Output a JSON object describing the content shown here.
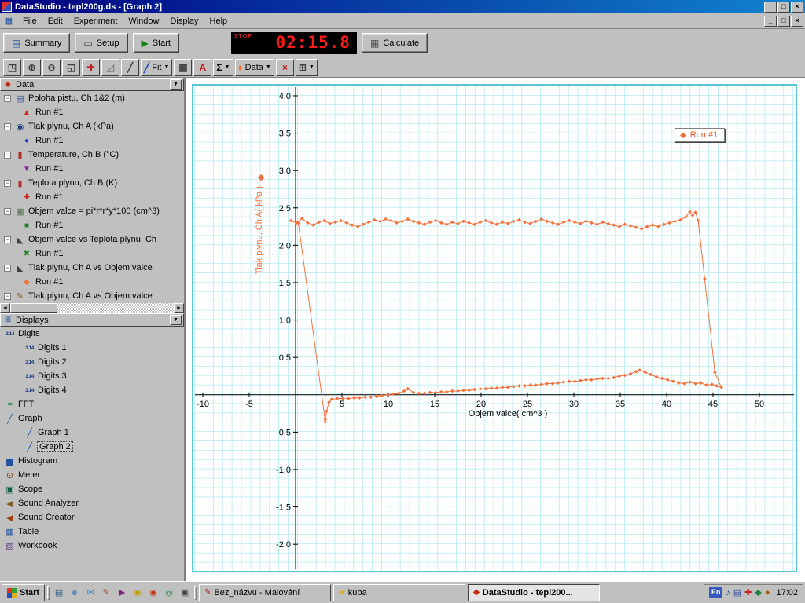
{
  "window": {
    "title": "DataStudio - tepl200g.ds - [Graph 2]"
  },
  "menu": {
    "items": [
      "File",
      "Edit",
      "Experiment",
      "Window",
      "Display",
      "Help"
    ]
  },
  "toolbar": {
    "summary": "Summary",
    "setup": "Setup",
    "start": "Start",
    "timer": {
      "stop_label": "STOP",
      "value": "02:15.8"
    },
    "calculate": "Calculate"
  },
  "graph_toolbar": {
    "buttons": [
      {
        "name": "scale-to-fit-button",
        "glyph": "◳",
        "color": "#404040"
      },
      {
        "name": "zoom-in-button",
        "glyph": "⊕",
        "color": "#404040"
      },
      {
        "name": "zoom-out-button",
        "glyph": "⊖",
        "color": "#404040"
      },
      {
        "name": "zoom-select-button",
        "glyph": "◱",
        "color": "#404040"
      },
      {
        "name": "smart-tool-button",
        "glyph": "✚",
        "color": "#c02020"
      },
      {
        "name": "slope-tool-button",
        "glyph": "◿",
        "color": "#808080"
      },
      {
        "name": "note-tool-button",
        "glyph": "╱",
        "color": "#404040"
      },
      {
        "name": "fit-menu-button",
        "glyph": "╱",
        "color": "#2040c0",
        "label": "Fit",
        "dropdown": true
      },
      {
        "name": "calculator-tool-button",
        "glyph": "▦",
        "color": "#404040"
      },
      {
        "name": "text-tool-button",
        "glyph": "A",
        "color": "#c02020"
      },
      {
        "name": "statistics-menu-button",
        "glyph": "Σ",
        "color": "#000000",
        "dropdown": true
      },
      {
        "name": "data-menu-button",
        "glyph": "♦",
        "color": "#f4713c",
        "label": "Data",
        "dropdown": true
      },
      {
        "name": "remove-button",
        "glyph": "×",
        "color": "#c02020"
      },
      {
        "name": "settings-menu-button",
        "glyph": "⊞",
        "color": "#404040",
        "dropdown": true
      }
    ]
  },
  "data_panel": {
    "title": "Data",
    "items": [
      {
        "label": "Poloha pistu, Ch 1&2 (m)",
        "icon": "▤",
        "icon_color": "#2050a0",
        "runs": [
          {
            "label": "Run #1",
            "marker": "▲",
            "color": "#d42828"
          }
        ]
      },
      {
        "label": "Tlak plynu, Ch A (kPa)",
        "icon": "◉",
        "icon_color": "#203880",
        "runs": [
          {
            "label": "Run #1",
            "marker": "●",
            "color": "#2038c8"
          }
        ]
      },
      {
        "label": "Temperature, Ch B (°C)",
        "icon": "▮",
        "icon_color": "#b03030",
        "runs": [
          {
            "label": "Run #1",
            "marker": "▼",
            "color": "#8828a0"
          }
        ]
      },
      {
        "label": "Teplota plynu, Ch B (K)",
        "icon": "▮",
        "icon_color": "#b03030",
        "runs": [
          {
            "label": "Run #1",
            "marker": "✚",
            "color": "#c82020"
          }
        ]
      },
      {
        "label": "Objem valce = pi*r*r*y*100 (cm^3)",
        "icon": "▦",
        "icon_color": "#507050",
        "runs": [
          {
            "label": "Run #1",
            "marker": "■",
            "color": "#288028"
          }
        ]
      },
      {
        "label": "Objem valce vs Teplota plynu, Ch",
        "icon": "◣",
        "icon_color": "#404040",
        "runs": [
          {
            "label": "Run #1",
            "marker": "✖",
            "color": "#208020"
          }
        ]
      },
      {
        "label": "Tlak plynu, Ch A vs Objem valce",
        "icon": "◣",
        "icon_color": "#404040",
        "runs": [
          {
            "label": "Run #1",
            "marker": "◆",
            "color": "#f4713c"
          }
        ]
      },
      {
        "label": "Tlak plynu, Ch A vs Objem valce",
        "icon": "✎",
        "icon_color": "#806020",
        "runs": []
      }
    ]
  },
  "displays_panel": {
    "title": "Displays",
    "items": [
      {
        "label": "Digits",
        "icon": "3.14",
        "icon_color": "#203880",
        "children": [
          {
            "label": "Digits 1"
          },
          {
            "label": "Digits 2"
          },
          {
            "label": "Digits 3"
          },
          {
            "label": "Digits 4"
          }
        ]
      },
      {
        "label": "FFT",
        "icon": "≈",
        "icon_color": "#108040"
      },
      {
        "label": "Graph",
        "icon": "╱",
        "icon_color": "#2050a0",
        "children": [
          {
            "label": "Graph 1"
          },
          {
            "label": "Graph 2",
            "selected": true
          }
        ]
      },
      {
        "label": "Histogram",
        "icon": "▆",
        "icon_color": "#2050a0"
      },
      {
        "label": "Meter",
        "icon": "⊙",
        "icon_color": "#804010"
      },
      {
        "label": "Scope",
        "icon": "▣",
        "icon_color": "#106040"
      },
      {
        "label": "Sound Analyzer",
        "icon": "◀",
        "icon_color": "#806020"
      },
      {
        "label": "Sound Creator",
        "icon": "◀",
        "icon_color": "#a04010"
      },
      {
        "label": "Table",
        "icon": "▦",
        "icon_color": "#2050a0"
      },
      {
        "label": "Workbook",
        "icon": "▧",
        "icon_color": "#604080"
      }
    ]
  },
  "chart_data": {
    "type": "scatter",
    "title": "",
    "xlabel": "Objem valce( cm^3 )",
    "ylabel": "Tlak plynu, Ch A( kPa )",
    "xlim": [
      -10.8,
      54
    ],
    "ylim": [
      -2.45,
      4.2
    ],
    "grid": true,
    "series_color": "#f4713c",
    "legend": {
      "label": "Run #1",
      "position": "top-right"
    },
    "xticks": [
      {
        "v": -10,
        "l": "-10"
      },
      {
        "v": -5,
        "l": "-5"
      },
      {
        "v": 5,
        "l": "5"
      },
      {
        "v": 10,
        "l": "10"
      },
      {
        "v": 15,
        "l": "15"
      },
      {
        "v": 20,
        "l": "20"
      },
      {
        "v": 25,
        "l": "25"
      },
      {
        "v": 30,
        "l": "30"
      },
      {
        "v": 35,
        "l": "35"
      },
      {
        "v": 40,
        "l": "40"
      },
      {
        "v": 45,
        "l": "45"
      },
      {
        "v": 50,
        "l": "50"
      }
    ],
    "yticks": [
      {
        "v": 4,
        "l": "4,0"
      },
      {
        "v": 3.5,
        "l": "3,5"
      },
      {
        "v": 3,
        "l": "3,0"
      },
      {
        "v": 2.5,
        "l": "2,5"
      },
      {
        "v": 2,
        "l": "2,0"
      },
      {
        "v": 1.5,
        "l": "1,5"
      },
      {
        "v": 1,
        "l": "1,0"
      },
      {
        "v": 0.5,
        "l": "0,5"
      },
      {
        "v": -0.5,
        "l": "-0,5"
      },
      {
        "v": -1,
        "l": "-1,0"
      },
      {
        "v": -1.5,
        "l": "-1,5"
      },
      {
        "v": -2,
        "l": "-2,0"
      }
    ],
    "points": [
      [
        3.2,
        -0.36
      ],
      [
        0.3,
        2.3
      ],
      [
        -0.5,
        2.33
      ],
      [
        0.1,
        2.3
      ],
      [
        0.7,
        2.36
      ],
      [
        1.3,
        2.3
      ],
      [
        1.9,
        2.27
      ],
      [
        2.5,
        2.31
      ],
      [
        3.1,
        2.33
      ],
      [
        3.7,
        2.29
      ],
      [
        4.3,
        2.31
      ],
      [
        4.9,
        2.33
      ],
      [
        5.5,
        2.3
      ],
      [
        6.1,
        2.27
      ],
      [
        6.7,
        2.25
      ],
      [
        7.3,
        2.28
      ],
      [
        7.9,
        2.31
      ],
      [
        8.5,
        2.34
      ],
      [
        9.1,
        2.32
      ],
      [
        9.7,
        2.35
      ],
      [
        10.3,
        2.33
      ],
      [
        10.9,
        2.3
      ],
      [
        11.5,
        2.32
      ],
      [
        12.1,
        2.35
      ],
      [
        12.7,
        2.32
      ],
      [
        13.3,
        2.3
      ],
      [
        13.9,
        2.28
      ],
      [
        14.5,
        2.31
      ],
      [
        15.1,
        2.33
      ],
      [
        15.7,
        2.3
      ],
      [
        16.3,
        2.28
      ],
      [
        16.9,
        2.31
      ],
      [
        17.5,
        2.29
      ],
      [
        18.1,
        2.32
      ],
      [
        18.7,
        2.3
      ],
      [
        19.3,
        2.28
      ],
      [
        19.9,
        2.31
      ],
      [
        20.5,
        2.33
      ],
      [
        21.1,
        2.3
      ],
      [
        21.7,
        2.28
      ],
      [
        22.3,
        2.31
      ],
      [
        22.9,
        2.29
      ],
      [
        23.5,
        2.32
      ],
      [
        24.1,
        2.34
      ],
      [
        24.7,
        2.31
      ],
      [
        25.3,
        2.29
      ],
      [
        25.9,
        2.32
      ],
      [
        26.5,
        2.35
      ],
      [
        27.1,
        2.32
      ],
      [
        27.7,
        2.3
      ],
      [
        28.3,
        2.28
      ],
      [
        28.9,
        2.31
      ],
      [
        29.5,
        2.33
      ],
      [
        30.1,
        2.31
      ],
      [
        30.7,
        2.29
      ],
      [
        31.3,
        2.32
      ],
      [
        31.9,
        2.3
      ],
      [
        32.5,
        2.28
      ],
      [
        33.1,
        2.31
      ],
      [
        33.7,
        2.29
      ],
      [
        34.3,
        2.27
      ],
      [
        34.9,
        2.25
      ],
      [
        35.5,
        2.28
      ],
      [
        36.1,
        2.26
      ],
      [
        36.7,
        2.24
      ],
      [
        37.3,
        2.22
      ],
      [
        37.9,
        2.25
      ],
      [
        38.5,
        2.27
      ],
      [
        39.1,
        2.25
      ],
      [
        39.7,
        2.28
      ],
      [
        40.3,
        2.3
      ],
      [
        40.9,
        2.32
      ],
      [
        41.5,
        2.34
      ],
      [
        42.1,
        2.38
      ],
      [
        42.5,
        2.45
      ],
      [
        42.8,
        2.4
      ],
      [
        43.1,
        2.44
      ],
      [
        43.4,
        2.33
      ],
      [
        44.1,
        1.55
      ],
      [
        45.2,
        0.3
      ],
      [
        45.9,
        0.1
      ],
      [
        45.4,
        0.12
      ],
      [
        44.9,
        0.14
      ],
      [
        44.3,
        0.13
      ],
      [
        43.7,
        0.16
      ],
      [
        43.1,
        0.15
      ],
      [
        42.5,
        0.17
      ],
      [
        41.9,
        0.15
      ],
      [
        41.3,
        0.16
      ],
      [
        40.7,
        0.18
      ],
      [
        40.1,
        0.2
      ],
      [
        39.5,
        0.22
      ],
      [
        38.9,
        0.24
      ],
      [
        38.3,
        0.27
      ],
      [
        37.7,
        0.3
      ],
      [
        37.1,
        0.33
      ],
      [
        36.7,
        0.31
      ],
      [
        36.1,
        0.28
      ],
      [
        35.5,
        0.26
      ],
      [
        34.9,
        0.25
      ],
      [
        34.3,
        0.23
      ],
      [
        33.7,
        0.22
      ],
      [
        33.1,
        0.22
      ],
      [
        32.5,
        0.21
      ],
      [
        31.9,
        0.2
      ],
      [
        31.3,
        0.2
      ],
      [
        30.7,
        0.19
      ],
      [
        30.1,
        0.18
      ],
      [
        29.5,
        0.18
      ],
      [
        28.9,
        0.17
      ],
      [
        28.3,
        0.16
      ],
      [
        27.7,
        0.15
      ],
      [
        27.1,
        0.15
      ],
      [
        26.5,
        0.14
      ],
      [
        25.9,
        0.13
      ],
      [
        25.3,
        0.13
      ],
      [
        24.7,
        0.12
      ],
      [
        24.1,
        0.12
      ],
      [
        23.5,
        0.11
      ],
      [
        22.9,
        0.1
      ],
      [
        22.3,
        0.1
      ],
      [
        21.7,
        0.09
      ],
      [
        21.1,
        0.09
      ],
      [
        20.5,
        0.08
      ],
      [
        19.9,
        0.08
      ],
      [
        19.3,
        0.07
      ],
      [
        18.7,
        0.06
      ],
      [
        18.1,
        0.06
      ],
      [
        17.5,
        0.05
      ],
      [
        16.9,
        0.05
      ],
      [
        16.3,
        0.04
      ],
      [
        15.7,
        0.04
      ],
      [
        15.1,
        0.03
      ],
      [
        14.5,
        0.03
      ],
      [
        13.9,
        0.02
      ],
      [
        13.3,
        0.02
      ],
      [
        12.7,
        0.03
      ],
      [
        12.1,
        0.08
      ],
      [
        11.7,
        0.05
      ],
      [
        11.1,
        0.02
      ],
      [
        10.5,
        0.01
      ],
      [
        9.9,
        0.0
      ],
      [
        9.3,
        -0.01
      ],
      [
        8.7,
        -0.02
      ],
      [
        8.1,
        -0.03
      ],
      [
        7.5,
        -0.03
      ],
      [
        6.9,
        -0.04
      ],
      [
        6.3,
        -0.04
      ],
      [
        5.7,
        -0.05
      ],
      [
        5.1,
        -0.05
      ],
      [
        4.5,
        -0.05
      ],
      [
        3.9,
        -0.06
      ],
      [
        3.6,
        -0.1
      ],
      [
        3.35,
        -0.22
      ],
      [
        3.2,
        -0.33
      ]
    ]
  },
  "taskbar": {
    "start": "Start",
    "quick_launch": [
      {
        "name": "show-desktop-icon",
        "glyph": "▤",
        "color": "#306080"
      },
      {
        "name": "internet-explorer-icon",
        "glyph": "e",
        "color": "#2060c0"
      },
      {
        "name": "outlook-express-icon",
        "glyph": "✉",
        "color": "#2080c0"
      },
      {
        "name": "paint-icon",
        "glyph": "✎",
        "color": "#a04020"
      },
      {
        "name": "media-player-icon",
        "glyph": "▶",
        "color": "#802080"
      },
      {
        "name": "winamp-icon",
        "glyph": "◉",
        "color": "#c0a000"
      },
      {
        "name": "realplayer-icon",
        "glyph": "◉",
        "color": "#c03010"
      },
      {
        "name": "browser-icon",
        "glyph": "◎",
        "color": "#208040"
      },
      {
        "name": "mail-icon",
        "glyph": "▣",
        "color": "#404040"
      }
    ],
    "tasks": [
      {
        "label": "Bez_názvu - Malování",
        "icon": "✎",
        "icon_color": "#a02020",
        "active": false
      },
      {
        "label": "kuba",
        "icon": "▰",
        "icon_color": "#d8b030",
        "active": false
      },
      {
        "label": "DataStudio - tepl200...",
        "icon": "◆",
        "icon_color": "#c03010",
        "active": true
      }
    ],
    "tray": {
      "lang": "En",
      "icons": [
        {
          "name": "volume-icon",
          "glyph": "♪",
          "color": "#204080"
        },
        {
          "name": "display-settings-icon",
          "glyph": "▤",
          "color": "#3050a0"
        },
        {
          "name": "antivirus-icon",
          "glyph": "✚",
          "color": "#c02020"
        },
        {
          "name": "scheduler-icon",
          "glyph": "◆",
          "color": "#208040"
        },
        {
          "name": "updater-icon",
          "glyph": "●",
          "color": "#a06010"
        }
      ],
      "time": "17:02"
    }
  }
}
